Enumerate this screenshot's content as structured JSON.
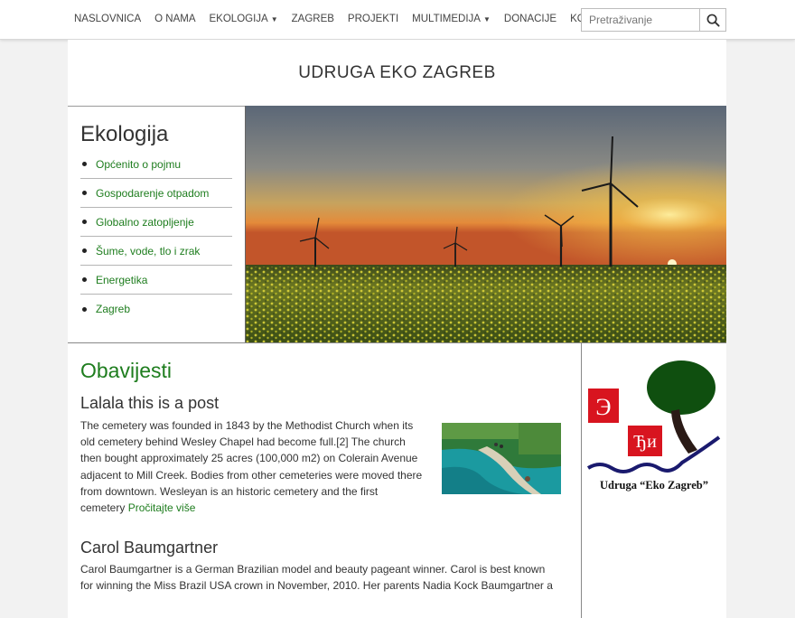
{
  "nav": {
    "items": [
      {
        "label": "NASLOVNICA",
        "dropdown": false
      },
      {
        "label": "O NAMA",
        "dropdown": false
      },
      {
        "label": "EKOLOGIJA",
        "dropdown": true
      },
      {
        "label": "ZAGREB",
        "dropdown": false
      },
      {
        "label": "PROJEKTI",
        "dropdown": false
      },
      {
        "label": "MULTIMEDIJA",
        "dropdown": true
      },
      {
        "label": "DONACIJE",
        "dropdown": false
      },
      {
        "label": "KONTAKT",
        "dropdown": false
      }
    ],
    "search_placeholder": "Pretraživanje",
    "search_icon": "search-icon"
  },
  "site": {
    "title": "UDRUGA EKO ZAGREB"
  },
  "sidebar": {
    "heading": "Ekologija",
    "items": [
      {
        "label": "Općenito o pojmu"
      },
      {
        "label": "Gospodarenje otpadom"
      },
      {
        "label": "Globalno zatopljenje"
      },
      {
        "label": "Šume, vode, tlo i zrak"
      },
      {
        "label": "Energetika"
      },
      {
        "label": "Zagreb"
      }
    ]
  },
  "main": {
    "heading": "Obavijesti",
    "posts": [
      {
        "title": "Lalala this is a post",
        "lines": [
          "The cemetery was founded in 1843 by the Methodist Church when its",
          "old cemetery behind Wesley Chapel had become full.[2] The church",
          "then bought approximately 25 acres (100,000 m2) on Colerain Avenue",
          "adjacent to Mill Creek. Bodies from other cemeteries were moved there",
          "from downtown.   Wesleyan is an historic cemetery and the first",
          "cemetery "
        ],
        "read_more": "Pročitajte više"
      },
      {
        "title": "Carol Baumgartner",
        "lines": [
          "Carol Baumgartner is a German Brazilian model and beauty pageant winner. Carol is best known",
          "for winning the Miss Brazil USA crown in November, 2010. Her parents Nadia Kock Baumgartner a"
        ]
      }
    ]
  },
  "logo": {
    "text": "Udruga “Eko Zagreb”",
    "letters": [
      "Э",
      "Ђи"
    ]
  },
  "colors": {
    "accent_green": "#1e7d1e",
    "logo_red": "#d8141f",
    "logo_navy": "#1a1a6e",
    "tree_green": "#0f4f0f"
  }
}
